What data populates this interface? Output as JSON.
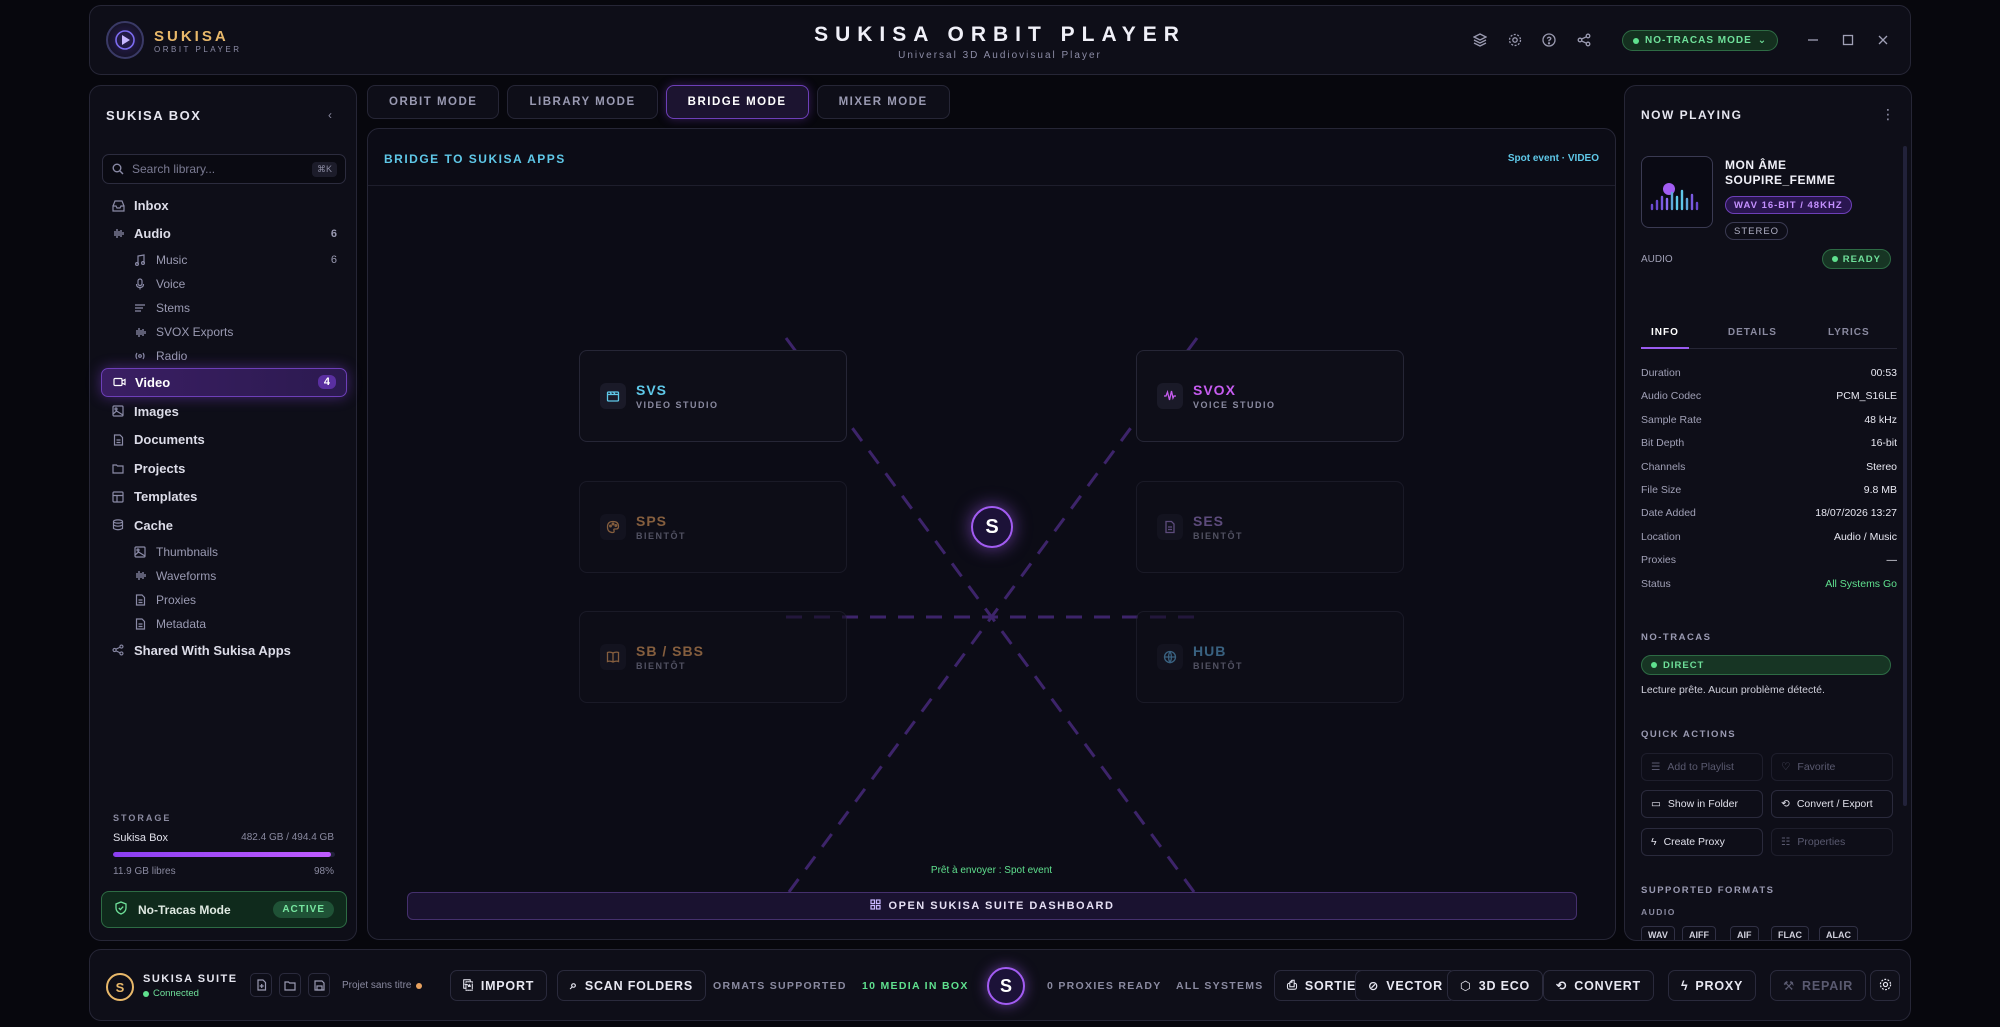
{
  "header": {
    "brand": "SUKISA",
    "brand_sub": "ORBIT PLAYER",
    "title": "SUKISA ORBIT PLAYER",
    "subtitle": "Universal 3D Audiovisual Player",
    "mode_label": "NO-TRACAS MODE",
    "icons": [
      "layers-icon",
      "gear-icon",
      "help-icon",
      "share-icon"
    ],
    "window_controls": [
      "minimize-icon",
      "maximize-icon",
      "close-icon"
    ]
  },
  "sidebar": {
    "title": "SUKISA BOX",
    "search_placeholder": "Search library...",
    "search_shortcut": "⌘K",
    "items": [
      {
        "label": "Inbox",
        "count": "",
        "sub": false,
        "icon": "inbox-icon"
      },
      {
        "label": "Audio",
        "count": "6",
        "sub": false,
        "icon": "waveform-icon"
      },
      {
        "label": "Music",
        "count": "6",
        "sub": true,
        "icon": "music-icon"
      },
      {
        "label": "Voice",
        "count": "",
        "sub": true,
        "icon": "mic-icon"
      },
      {
        "label": "Stems",
        "count": "",
        "sub": true,
        "icon": "stems-icon"
      },
      {
        "label": "SVOX Exports",
        "count": "",
        "sub": true,
        "icon": "waveform-icon"
      },
      {
        "label": "Radio",
        "count": "",
        "sub": true,
        "icon": "radio-icon"
      },
      {
        "label": "Video",
        "count": "4",
        "sub": false,
        "icon": "video-icon",
        "active": true
      },
      {
        "label": "Images",
        "count": "",
        "sub": false,
        "icon": "image-icon"
      },
      {
        "label": "Documents",
        "count": "",
        "sub": false,
        "icon": "document-icon"
      },
      {
        "label": "Projects",
        "count": "",
        "sub": false,
        "icon": "folder-icon"
      },
      {
        "label": "Templates",
        "count": "",
        "sub": false,
        "icon": "template-icon"
      },
      {
        "label": "Cache",
        "count": "",
        "sub": false,
        "icon": "database-icon"
      },
      {
        "label": "Thumbnails",
        "count": "",
        "sub": true,
        "icon": "image-icon"
      },
      {
        "label": "Waveforms",
        "count": "",
        "sub": true,
        "icon": "waveform-icon"
      },
      {
        "label": "Proxies",
        "count": "",
        "sub": true,
        "icon": "document-icon"
      },
      {
        "label": "Metadata",
        "count": "",
        "sub": true,
        "icon": "document-icon"
      },
      {
        "label": "Shared With Sukisa Apps",
        "count": "",
        "sub": false,
        "icon": "share-icon"
      }
    ],
    "storage": {
      "label": "STORAGE",
      "name": "Sukisa Box",
      "value": "482.4 GB / 494.4 GB",
      "free": "11.9 GB libres",
      "percent": "98%",
      "fill": 0.98
    },
    "no_tracas": {
      "label": "No-Tracas Mode",
      "badge": "ACTIVE"
    }
  },
  "main": {
    "tabs": [
      "ORBIT MODE",
      "LIBRARY MODE",
      "BRIDGE MODE",
      "MIXER MODE"
    ],
    "active_tab": 2,
    "stage_title": "BRIDGE TO SUKISA APPS",
    "stage_right": "Spot event · VIDEO",
    "hub_letter": "S",
    "cards": [
      {
        "name": "SVS",
        "sub": "VIDEO STUDIO",
        "color": "#5fc8e8",
        "dim": false
      },
      {
        "name": "SVOX",
        "sub": "VOICE STUDIO",
        "color": "#c65cf0",
        "dim": false
      },
      {
        "name": "SPS",
        "sub": "BIENTÔT",
        "color": "#e8a25f",
        "dim": true
      },
      {
        "name": "SES",
        "sub": "BIENTÔT",
        "color": "#a080d0",
        "dim": true
      },
      {
        "name": "SB / SBS",
        "sub": "BIENTÔT",
        "color": "#e8a25f",
        "dim": true
      },
      {
        "name": "HUB",
        "sub": "BIENTÔT",
        "color": "#5fa8d8",
        "dim": true
      }
    ],
    "ready_text": "Prêt à envoyer : Spot event",
    "dashboard_button": "OPEN SUKISA SUITE DASHBOARD"
  },
  "now_playing": {
    "title": "NOW PLAYING",
    "track": "MON ÂME SOUPIRE_FEMME",
    "format": "WAV 16-BIT / 48KHZ",
    "channels_badge": "STEREO",
    "type": "AUDIO",
    "status": "READY",
    "tabs": [
      "INFO",
      "DETAILS",
      "LYRICS"
    ],
    "info": [
      {
        "k": "Duration",
        "v": "00:53"
      },
      {
        "k": "Audio Codec",
        "v": "PCM_S16LE"
      },
      {
        "k": "Sample Rate",
        "v": "48 kHz"
      },
      {
        "k": "Bit Depth",
        "v": "16-bit"
      },
      {
        "k": "Channels",
        "v": "Stereo"
      },
      {
        "k": "File Size",
        "v": "9.8 MB"
      },
      {
        "k": "Date Added",
        "v": "18/07/2026 13:27"
      },
      {
        "k": "Location",
        "v": "Audio / Music"
      },
      {
        "k": "Proxies",
        "v": "—"
      },
      {
        "k": "Status",
        "v": "All Systems Go"
      }
    ],
    "no_tracas_title": "NO-TRACAS",
    "direct": "DIRECT",
    "lecture": "Lecture prête. Aucun problème détecté.",
    "quick_title": "QUICK ACTIONS",
    "quick_actions": [
      {
        "label": "Add to Playlist",
        "dim": true
      },
      {
        "label": "Favorite",
        "dim": true
      },
      {
        "label": "Show in Folder",
        "dim": false
      },
      {
        "label": "Convert / Export",
        "dim": false
      },
      {
        "label": "Create Proxy",
        "dim": false
      },
      {
        "label": "Properties",
        "dim": true
      }
    ],
    "formats_title": "SUPPORTED FORMATS",
    "formats_sub": "AUDIO",
    "formats": [
      "WAV",
      "AIFF",
      "AIF",
      "FLAC",
      "ALAC"
    ]
  },
  "footer": {
    "logo": "S",
    "suite": "SUKISA SUITE",
    "connected": "Connected",
    "project": "Projet sans titre",
    "import": "IMPORT",
    "scan": "SCAN FOLDERS",
    "formats_supported": "ORMATS SUPPORTED",
    "media_in_box": "10 MEDIA IN BOX",
    "hub": "S",
    "proxies_ready": "0 PROXIES READY",
    "all_systems": "ALL SYSTEMS",
    "actions": [
      "SORTIE",
      "VECTOR",
      "3D ECO",
      "CONVERT",
      "PROXY",
      "REPAIR"
    ]
  },
  "colors": {
    "accent": "#a25cf2",
    "success": "#5fe08e",
    "brand": "#e8b86a",
    "cyan": "#5fc8e8"
  }
}
